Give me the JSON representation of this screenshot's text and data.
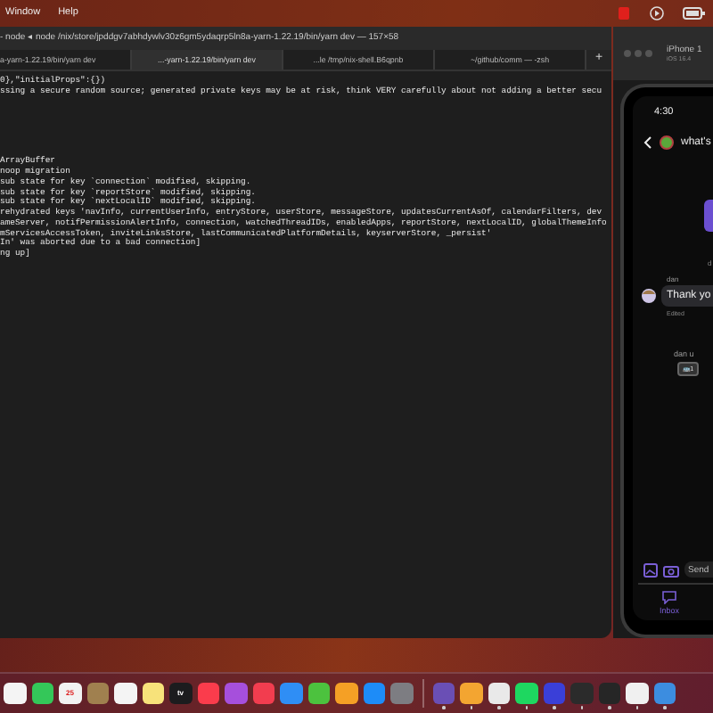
{
  "menu_bar": {
    "items": [
      "Window",
      "Help"
    ]
  },
  "terminal": {
    "title": "- node ◂ node /nix/store/jpddgv7abhdywlv30z6gm5ydaqrp5ln8a-yarn-1.22.19/bin/yarn dev — 157×58",
    "tabs": [
      {
        "label": "a-yarn-1.22.19/bin/yarn dev",
        "selected": false
      },
      {
        "label": "...-yarn-1.22.19/bin/yarn dev",
        "selected": true
      },
      {
        "label": "...le /tmp/nix-shell.B6qpnb",
        "selected": false
      },
      {
        "label": "~/github/comm — -zsh",
        "selected": false
      }
    ],
    "new_tab": "+",
    "header_lines": [
      "0},\"initialProps\":{})",
      "ssing a secure random source; generated private keys may be at risk, think VERY carefully about not adding a better secu"
    ],
    "log_lines": [
      "ArrayBuffer",
      "noop migration",
      "sub state for key `connection` modified, skipping.",
      "sub state for key `reportStore` modified, skipping.",
      "sub state for key `nextLocalID` modified, skipping.",
      "rehydrated keys 'navInfo, currentUserInfo, entryStore, userStore, messageStore, updatesCurrentAsOf, calendarFilters, dev",
      "ameServer, notifPermissionAlertInfo, connection, watchedThreadIDs, enabledApps, reportStore, nextLocalID, globalThemeInfo",
      "mServicesAccessToken, inviteLinksStore, lastCommunicatedPlatformDetails, keyserverStore, _persist'",
      "In' was aborted due to a bad connection]",
      "ng up]"
    ]
  },
  "simulator": {
    "device": "iPhone 1",
    "os": "iOS 16.4",
    "time": "4:30",
    "thread_title": "what's",
    "sender_top": "d",
    "sender": "dan",
    "message": "Thank yo",
    "edited": "Edited",
    "notice": "dan u",
    "reactions": [
      {
        "emoji": "🚌",
        "count": "1"
      }
    ],
    "composer": {
      "placeholder": "Send"
    },
    "tab": {
      "label": "Inbox",
      "selected": true
    }
  },
  "dock": [
    {
      "color": "#f4f4f4",
      "running": false
    },
    {
      "color": "#34c759",
      "running": false
    },
    {
      "color": "#f2f2f2",
      "label": "25",
      "running": false
    },
    {
      "color": "#a0804f",
      "running": false
    },
    {
      "color": "#f4f4f4",
      "running": false
    },
    {
      "color": "#f7e27a",
      "running": false
    },
    {
      "color": "#1c1c1e",
      "label": "tv",
      "running": false
    },
    {
      "color": "#fa3c4c",
      "running": false
    },
    {
      "color": "#a64fdc",
      "running": false
    },
    {
      "color": "#f23d4f",
      "running": false
    },
    {
      "color": "#2f8ef5",
      "running": false
    },
    {
      "color": "#4cc23e",
      "running": false
    },
    {
      "color": "#f5a025",
      "running": false
    },
    {
      "color": "#1d8cf8",
      "running": false
    },
    {
      "color": "#7d7d82",
      "running": false
    },
    {
      "color": "#6a4fb5",
      "running": true
    },
    {
      "color": "#f3a531",
      "running": true
    },
    {
      "color": "#e9e9e9",
      "running": true
    },
    {
      "color": "#1ed760",
      "running": true
    },
    {
      "color": "#3a3fd8",
      "running": true
    },
    {
      "color": "#2b2b2b",
      "running": true
    },
    {
      "color": "#262626",
      "running": true
    },
    {
      "color": "#f0f0f0",
      "running": true
    },
    {
      "color": "#3c8de0",
      "running": true
    }
  ]
}
